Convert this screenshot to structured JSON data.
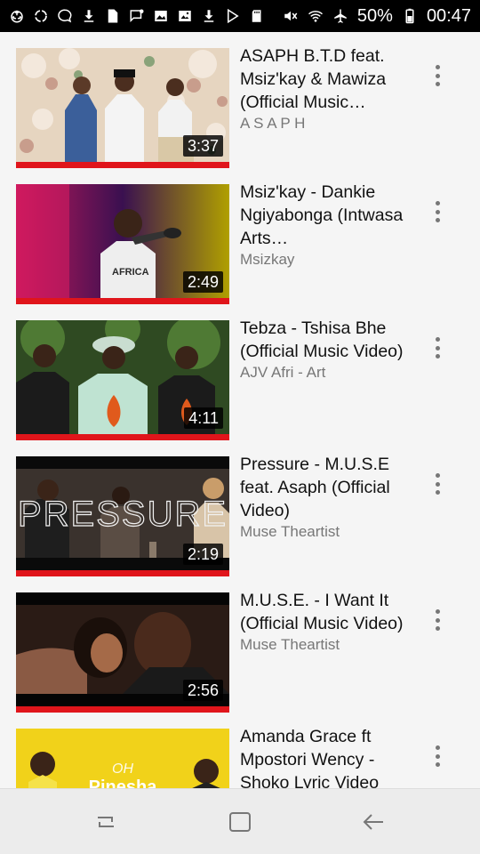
{
  "status_bar": {
    "battery_percent": "50%",
    "time": "00:47",
    "left_icons": [
      "recycle-icon",
      "recycle-icon",
      "chat-icon",
      "download-icon",
      "document-icon",
      "message-icon",
      "gallery-icon",
      "image-icon",
      "download-icon",
      "play-store-icon",
      "sd-card-icon"
    ],
    "right_icons": [
      "mute-icon",
      "wifi-icon",
      "airplane-icon"
    ]
  },
  "videos": [
    {
      "title": "ASAPH B.T.D feat. Msiz'kay & Mawiza (Official Music…",
      "channel": "A S A P H",
      "duration": "3:37",
      "thumb_colors": [
        "#d8c7b4",
        "#e9d9c6",
        "#6b5a4a"
      ]
    },
    {
      "title": "Msiz'kay - Dankie Ngiyabonga (Intwasa Arts…",
      "channel": "Msizkay",
      "duration": "2:49",
      "thumb_colors": [
        "#b0165f",
        "#3b0f55",
        "#f0f0f0"
      ]
    },
    {
      "title": "Tebza - Tshisa Bhe (Official Music Video)",
      "channel": "AJV Afri - Art",
      "duration": "4:11",
      "thumb_colors": [
        "#3d5e2a",
        "#1d2a18",
        "#b9d9c9"
      ]
    },
    {
      "title": "Pressure - M.U.S.E feat. Asaph (Official Video)",
      "channel": "Muse Theartist",
      "duration": "2:19",
      "thumb_colors": [
        "#3e3631",
        "#7a6b5f",
        "#1f1a17"
      ],
      "overlay_text": "PRESSURE"
    },
    {
      "title": "M.U.S.E. - I Want It (Official Music Video)",
      "channel": "Muse Theartist",
      "duration": "2:56",
      "thumb_colors": [
        "#6c4636",
        "#2a1b15",
        "#b88868"
      ]
    },
    {
      "title": "Amanda Grace ft Mpostori Wency - Shoko Lyric Video",
      "channel": "",
      "duration": "",
      "thumb_colors": [
        "#f1d21a",
        "#e9bf0c",
        "#ffffff"
      ],
      "overlay_text": "OH Pinesha"
    }
  ],
  "colors": {
    "progress_bar": "#e0151b",
    "background": "#f5f5f5",
    "status_bar": "#000000"
  },
  "nav_bar": {
    "icons": [
      "recents-icon",
      "home-icon",
      "back-icon"
    ]
  }
}
